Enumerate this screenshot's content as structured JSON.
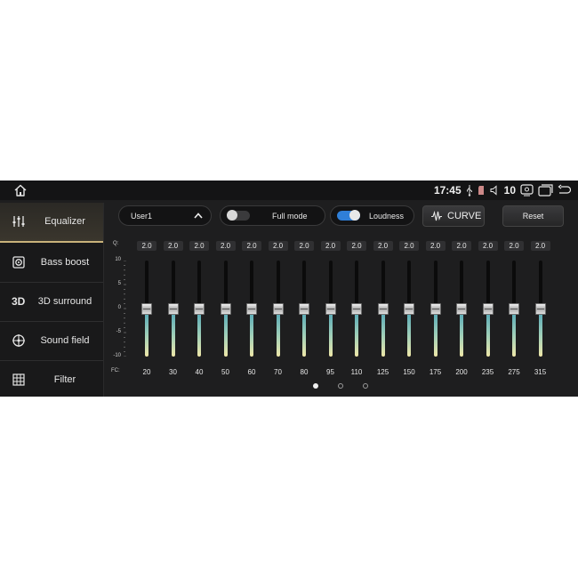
{
  "statusbar": {
    "time": "17:45",
    "volume": "10",
    "icons": [
      "home-icon",
      "usb-icon",
      "sd-card-icon",
      "volume-icon",
      "screen-capture-icon",
      "multi-window-icon",
      "back-icon"
    ]
  },
  "sidebar": {
    "items": [
      {
        "label": "Equalizer",
        "icon": "equalizer-icon",
        "active": true
      },
      {
        "label": "Bass boost",
        "icon": "speaker-icon",
        "active": false
      },
      {
        "label": "3D surround",
        "icon": "3d-icon",
        "active": false
      },
      {
        "label": "Sound field",
        "icon": "sound-field-icon",
        "active": false
      },
      {
        "label": "Filter",
        "icon": "filter-grid-icon",
        "active": false
      }
    ]
  },
  "toolbar": {
    "preset_label": "User1",
    "full_mode_label": "Full mode",
    "full_mode_on": false,
    "loudness_label": "Loudness",
    "loudness_on": true,
    "curve_label": "CURVE",
    "reset_label": "Reset"
  },
  "eq": {
    "q_label": "Q:",
    "fc_label": "FC:",
    "y_ticks": [
      "10",
      "5",
      "0",
      "-5",
      "-10"
    ],
    "y_range": [
      -10,
      10
    ],
    "bands": [
      {
        "fc": "20",
        "q": "2.0",
        "gain": 0
      },
      {
        "fc": "30",
        "q": "2.0",
        "gain": 0
      },
      {
        "fc": "40",
        "q": "2.0",
        "gain": 0
      },
      {
        "fc": "50",
        "q": "2.0",
        "gain": 0
      },
      {
        "fc": "60",
        "q": "2.0",
        "gain": 0
      },
      {
        "fc": "70",
        "q": "2.0",
        "gain": 0
      },
      {
        "fc": "80",
        "q": "2.0",
        "gain": 0
      },
      {
        "fc": "95",
        "q": "2.0",
        "gain": 0
      },
      {
        "fc": "110",
        "q": "2.0",
        "gain": 0
      },
      {
        "fc": "125",
        "q": "2.0",
        "gain": 0
      },
      {
        "fc": "150",
        "q": "2.0",
        "gain": 0
      },
      {
        "fc": "175",
        "q": "2.0",
        "gain": 0
      },
      {
        "fc": "200",
        "q": "2.0",
        "gain": 0
      },
      {
        "fc": "235",
        "q": "2.0",
        "gain": 0
      },
      {
        "fc": "275",
        "q": "2.0",
        "gain": 0
      },
      {
        "fc": "315",
        "q": "2.0",
        "gain": 0
      }
    ]
  },
  "pager": {
    "pages": 3,
    "current": 0
  },
  "colors": {
    "accent": "#c9b27a",
    "toggle_on": "#2f7fd8",
    "slider_top": "#4aa3b8",
    "slider_bottom": "#efe7a9"
  }
}
